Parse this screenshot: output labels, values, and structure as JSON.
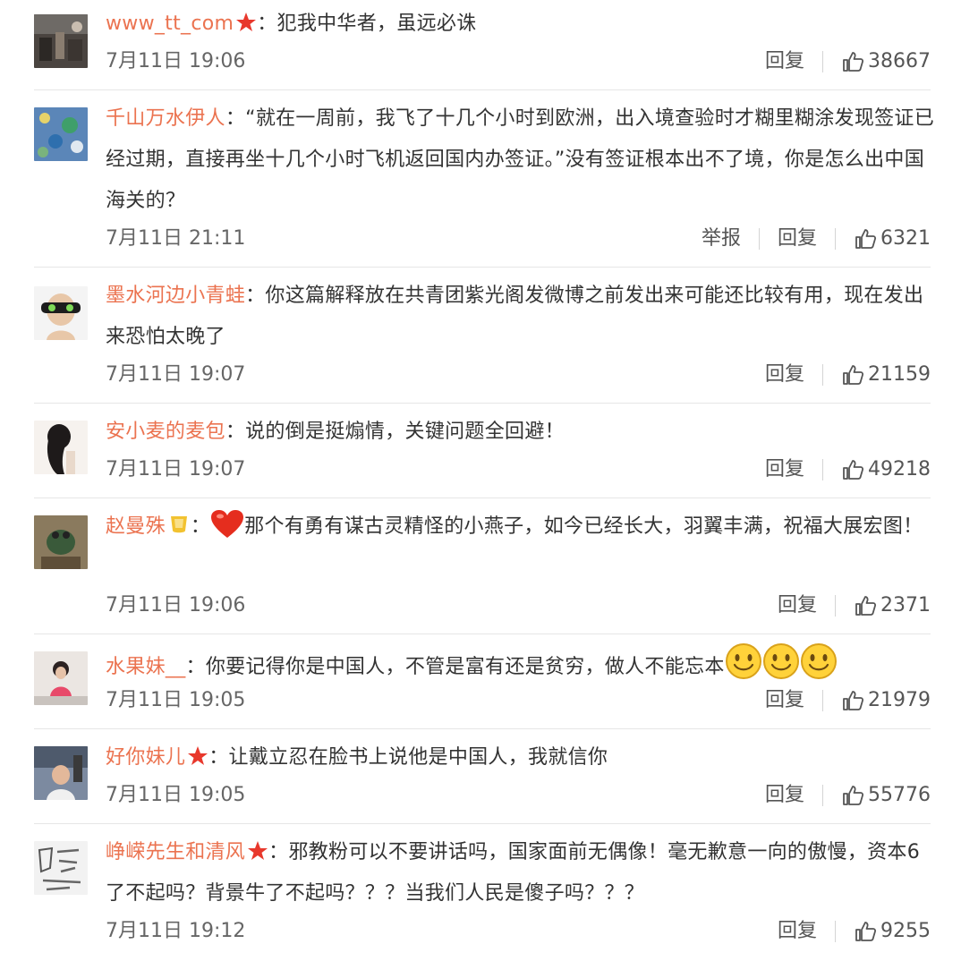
{
  "colors": {
    "username": "#eb7350",
    "text": "#333333",
    "meta": "#666666",
    "divider": "#e6e6e6"
  },
  "comments": [
    {
      "user": "www_tt_com",
      "badge": "star-badge-icon",
      "sep": "：",
      "text": "犯我中华者，虽远必诛",
      "time": "7月11日 19:06",
      "report": "",
      "reply": "回复",
      "likes": "38667"
    },
    {
      "user": "千山万水伊人",
      "badge": "",
      "sep": "：",
      "text": "“就在一周前，我飞了十几个小时到欧洲，出入境查验时才糊里糊涂发现签证已经过期，直接再坐十几个小时飞机返回国内办签证。”没有签证根本出不了境，你是怎么出中国海关的？",
      "time": "7月11日 21:11",
      "report": "举报",
      "reply": "回复",
      "likes": "6321"
    },
    {
      "user": "墨水河边小青蛙",
      "badge": "",
      "sep": "：",
      "text": "你这篇解释放在共青团紫光阁发微博之前发出来可能还比较有用，现在发出来恐怕太晚了",
      "time": "7月11日 19:07",
      "report": "",
      "reply": "回复",
      "likes": "21159"
    },
    {
      "user": "安小麦的麦包",
      "badge": "",
      "sep": "：",
      "text": "说的倒是挺煽情，关键问题全回避！",
      "time": "7月11日 19:07",
      "report": "",
      "reply": "回复",
      "likes": "49218"
    },
    {
      "user": "赵曼殊",
      "badge": "gold-badge-icon",
      "sep": "：",
      "lead_emoji": "heart-icon",
      "text": "那个有勇有谋古灵精怪的小燕子，如今已经长大，羽翼丰满，祝福大展宏图！",
      "time": "7月11日 19:06",
      "report": "",
      "reply": "回复",
      "likes": "2371"
    },
    {
      "user": "水果妹__",
      "badge": "",
      "sep": "：",
      "text": "你要记得你是中国人，不管是富有还是贫穷，做人不能忘本",
      "trail_emoji": [
        "smile-icon",
        "smile-icon",
        "smile-icon"
      ],
      "time": "7月11日 19:05",
      "report": "",
      "reply": "回复",
      "likes": "21979"
    },
    {
      "user": "好你妹儿",
      "badge": "star-badge-icon",
      "sep": "：",
      "text": "让戴立忍在脸书上说他是中国人，我就信你",
      "time": "7月11日 19:05",
      "report": "",
      "reply": "回复",
      "likes": "55776"
    },
    {
      "user": "峥嵘先生和清风",
      "badge": "star-badge-icon",
      "sep": "：",
      "text": "邪教粉可以不要讲话吗，国家面前无偶像！毫无歉意一向的傲慢，资本6了不起吗？背景牛了不起吗？？？当我们人民是傻子吗？？？",
      "time": "7月11日 19:12",
      "report": "",
      "reply": "回复",
      "likes": "9255"
    }
  ]
}
